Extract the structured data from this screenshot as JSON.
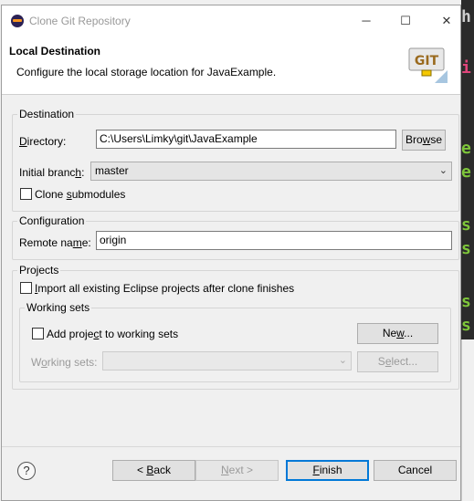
{
  "window": {
    "title": "Clone Git Repository",
    "minimize_glyph": "─",
    "maximize_glyph": "☐",
    "close_glyph": "✕"
  },
  "header": {
    "title": "Local Destination",
    "description": "Configure the local storage location for JavaExample.",
    "logo_text": "GIT"
  },
  "destination": {
    "legend": "Destination",
    "directory_label": "Directory:",
    "directory_value": "C:\\Users\\Limky\\git\\JavaExample",
    "browse_label": "Browse",
    "initial_branch_label": "Initial branch:",
    "initial_branch_value": "master",
    "clone_submodules_label": "Clone submodules",
    "clone_submodules_checked": false
  },
  "configuration": {
    "legend": "Configuration",
    "remote_name_label": "Remote name:",
    "remote_name_value": "origin"
  },
  "projects": {
    "legend": "Projects",
    "import_label": "Import all existing Eclipse projects after clone finishes",
    "import_checked": false,
    "working_sets": {
      "legend": "Working sets",
      "add_label": "Add project to working sets",
      "add_checked": false,
      "new_label": "New...",
      "working_sets_label": "Working sets:",
      "working_sets_value": "",
      "select_label": "Select..."
    }
  },
  "footer": {
    "help_glyph": "?",
    "back_label": "< Back",
    "next_label": "Next >",
    "finish_label": "Finish",
    "cancel_label": "Cancel"
  },
  "colors": {
    "accent": "#0078d7",
    "ide_background": "#2b2b2b",
    "ide_glyph_green": "#7ec63a",
    "ide_glyph_pink": "#e0457b"
  }
}
